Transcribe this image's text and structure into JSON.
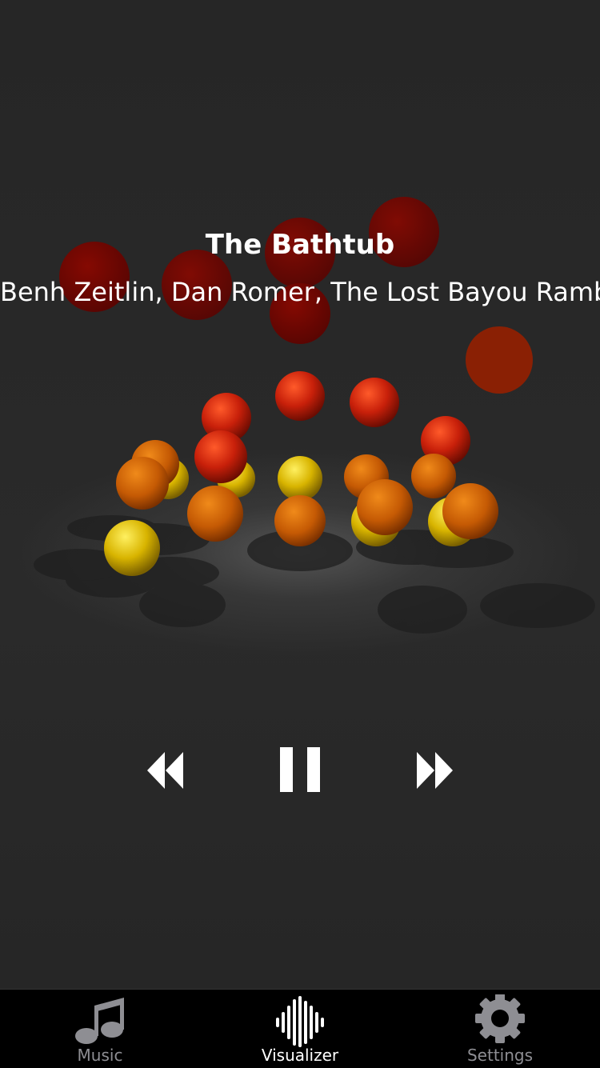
{
  "now_playing": {
    "title": "The Bathtub",
    "artist": "Benh Zeitlin, Dan Romer, The Lost Bayou Ramb..."
  },
  "controls": {
    "rewind_icon": "rewind-icon",
    "pause_icon": "pause-icon",
    "fast_forward_icon": "fast-forward-icon"
  },
  "tabbar": {
    "tabs": [
      {
        "label": "Music",
        "icon": "music-note-icon",
        "selected": false
      },
      {
        "label": "Visualizer",
        "icon": "waveform-icon",
        "selected": true
      },
      {
        "label": "Settings",
        "icon": "gear-icon",
        "selected": false
      }
    ],
    "colors": {
      "selected": "#ffffff",
      "unselected": "#8e8e93"
    }
  },
  "colors": {
    "background": "#262626",
    "ball_red": "#d42a0a",
    "ball_orange": "#d46a00",
    "ball_yellow": "#e8c400"
  }
}
